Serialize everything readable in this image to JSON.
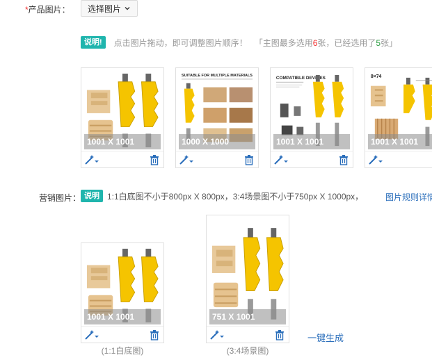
{
  "product_images": {
    "required_mark": "*",
    "label": "产品图片：",
    "select_button": "选择图片",
    "badge": "说明!",
    "instruction": "点击图片拖动，即可调整图片顺序！",
    "limit_prefix": "「主图最多选用",
    "limit_max": "6",
    "limit_mid": "张，已经选用了",
    "limit_used": "5",
    "limit_suffix": "张」",
    "cards": [
      {
        "dims": "1001 X 1001",
        "image": "router-bit-wood-samples"
      },
      {
        "dims": "1000 X 1000",
        "image": "suitable-for-multiple-materials",
        "heading": "SUITABLE FOR MULTIPLE MATERIALS"
      },
      {
        "dims": "1001 X 1001",
        "image": "compatible-devices",
        "heading": "COMPATIBLE DEVICES"
      },
      {
        "dims": "1001 X 1001",
        "image": "dimension-diagram",
        "heading": "8×74"
      }
    ]
  },
  "marketing_images": {
    "label": "营销图片：",
    "badge": "说明",
    "description": "1:1白底图不小于800px X 800px，3:4场景图不小于750px X 1000px，",
    "rules_link": "图片规则详情",
    "cards": [
      {
        "dims": "1001 X 1001",
        "caption": "(1:1白底图)"
      },
      {
        "dims": "751 X 1001",
        "caption": "(3:4场景图)"
      }
    ],
    "generate_link": "一键生成"
  },
  "colors": {
    "badge": "#1fb5ad",
    "highlight_red": "#f23030",
    "highlight_green": "#2e9e44",
    "link": "#2a6ebb",
    "bit_yellow": "#f5c400"
  }
}
